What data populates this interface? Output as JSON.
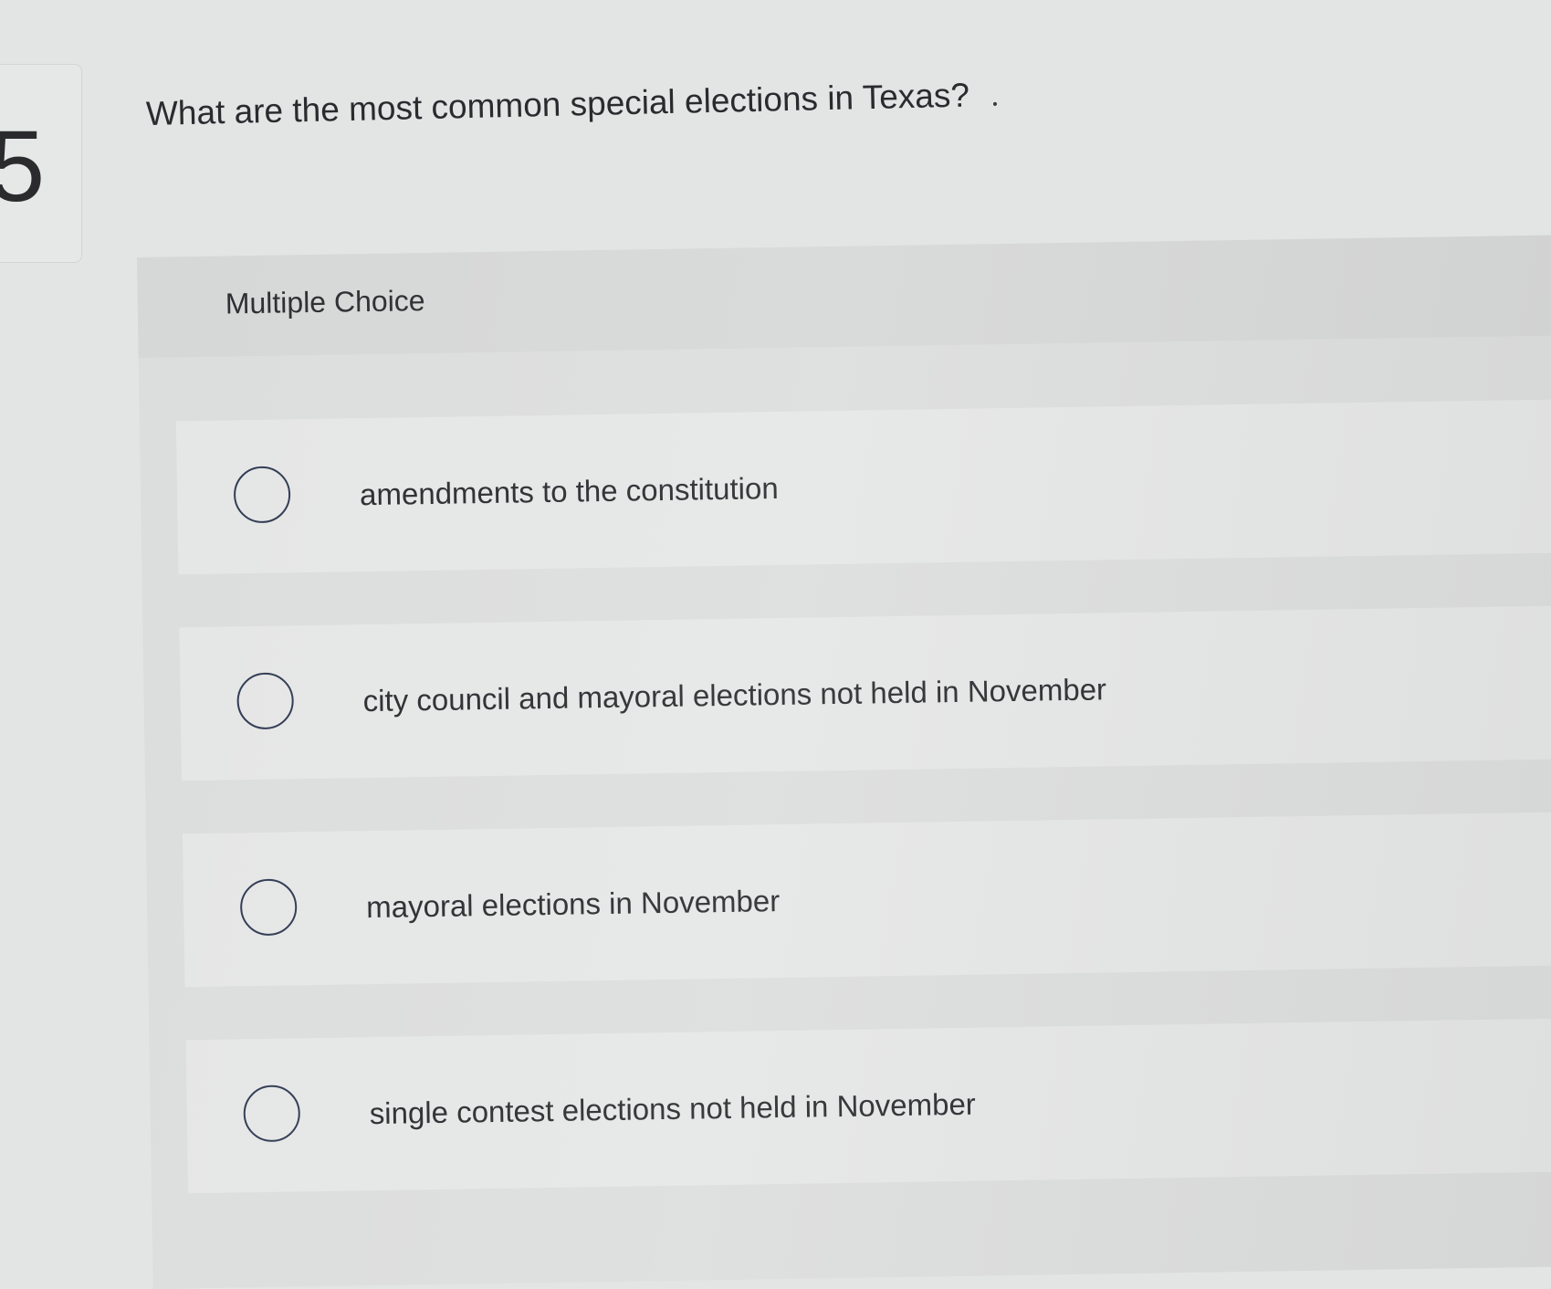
{
  "question": {
    "number": "5",
    "text": "What are the most common special elections in Texas?"
  },
  "panel": {
    "label": "Multiple Choice"
  },
  "options": [
    {
      "label": "amendments to the constitution",
      "selected": false
    },
    {
      "label": "city council and mayoral elections not held in November",
      "selected": false
    },
    {
      "label": "mayoral elections in November",
      "selected": false
    },
    {
      "label": "single contest elections not held in November",
      "selected": false
    }
  ]
}
